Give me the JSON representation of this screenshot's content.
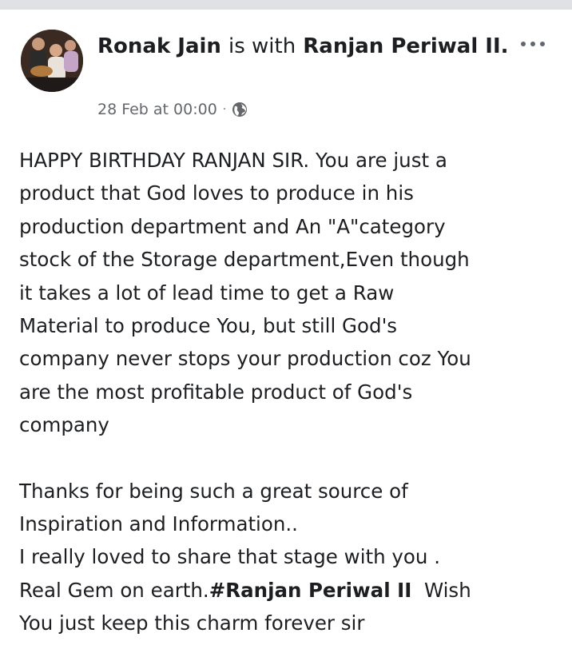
{
  "post": {
    "author": "Ronak Jain",
    "with_text": "is with",
    "tagged": "Ranjan Periwal II.",
    "timestamp": "28 Feb at 00:00",
    "separator": "·",
    "privacy_icon": "globe-icon",
    "more_icon": "more-options-icon",
    "body": {
      "paragraph1": [
        "HAPPY BIRTHDAY RANJAN SIR. You are just a",
        "product that God loves to produce in his",
        "production department and An \"A\"category",
        "stock of the Storage department,Even though",
        "it takes a lot of lead time to get a Raw",
        "Material to produce You, but still God's",
        "company never stops your production coz You",
        "are the most profitable product of God's",
        "company"
      ],
      "paragraph2": [
        "Thanks for being such a great source of",
        "Inspiration and Information..",
        "I really loved to share that stage with you ."
      ],
      "line_gem_prefix": "Real Gem on earth.",
      "line_gem_mention": "#Ranjan Periwal II",
      "line_gem_suffix": "Wish",
      "line_last": "You just keep this charm forever sir"
    }
  },
  "colors": {
    "text": "#1c1e21",
    "meta": "#65676b",
    "topbar": "#dfe1e5"
  }
}
